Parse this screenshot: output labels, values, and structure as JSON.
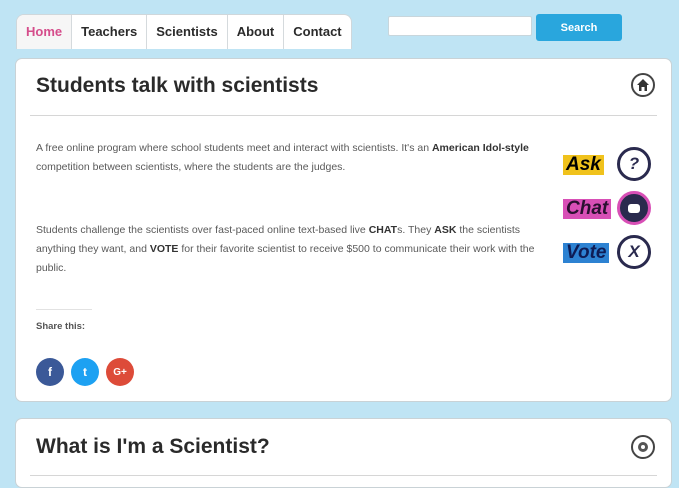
{
  "nav": {
    "tabs": [
      {
        "label": "Home"
      },
      {
        "label": "Teachers"
      },
      {
        "label": "Scientists"
      },
      {
        "label": "About"
      },
      {
        "label": "Contact"
      }
    ],
    "active_index": 0,
    "search_placeholder": "",
    "search_button": "Search"
  },
  "card1": {
    "title": "Students talk with scientists",
    "para1_a": "A free online program where school students meet and interact with scientists. It's an ",
    "para1_bold": "American Idol-style",
    "para1_b": " competition between scientists, where the students are the judges.",
    "para2_a": "Students challenge the scientists over fast-paced online text-based live ",
    "para2_chat": "CHAT",
    "para2_b": "s. They ",
    "para2_ask": "ASK",
    "para2_c": " the scientists anything they want, and ",
    "para2_vote": "VOTE",
    "para2_d": " for their favorite scientist to receive $500 to communicate their work with the public.",
    "share_label": "Share this:",
    "share_buttons": {
      "facebook": "f",
      "twitter": "t",
      "google": "G+"
    },
    "badges": {
      "ask_word": "Ask",
      "ask_symbol": "?",
      "chat_word": "Chat",
      "vote_word": "Vote",
      "vote_symbol": "X"
    }
  },
  "card2": {
    "title": "What is I'm a Scientist?"
  },
  "colors": {
    "background": "#bfe4f4",
    "active_tab": "#d54d8b",
    "search_button": "#29a6dd",
    "facebook": "#3b5998",
    "twitter": "#1da1f2",
    "google": "#dd4b39",
    "ask": "#f0c21c",
    "chat": "#d84fb6",
    "vote": "#2d82d2"
  }
}
